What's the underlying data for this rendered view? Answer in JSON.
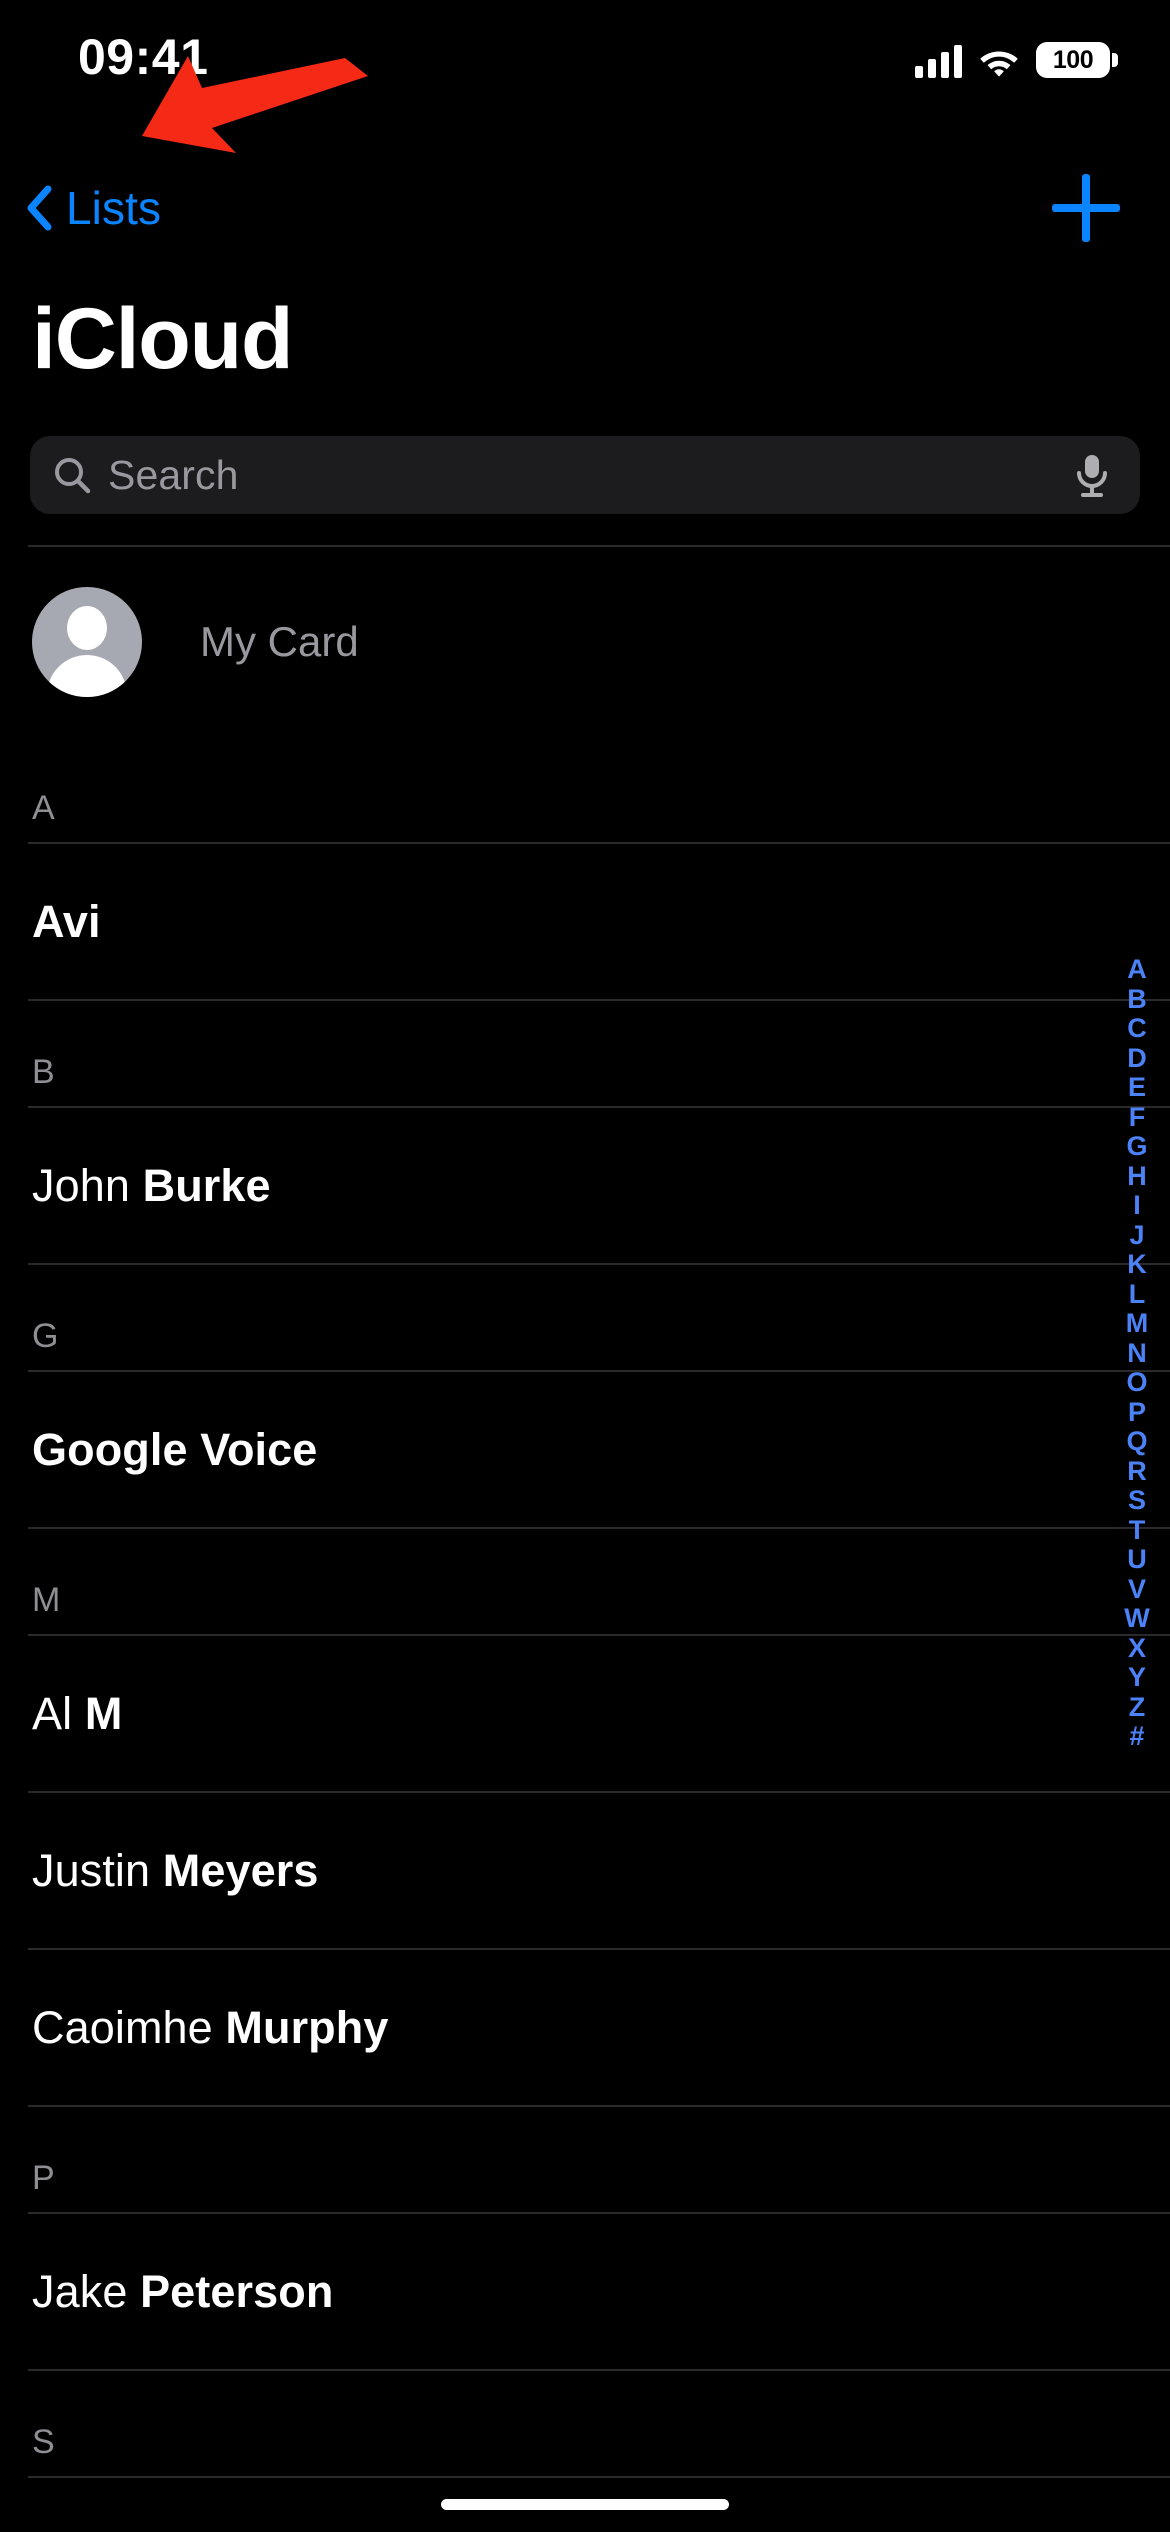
{
  "status_bar": {
    "time": "09:41",
    "cellular_icon": "cellular-bars-icon",
    "wifi_icon": "wifi-icon",
    "battery_percent": "100"
  },
  "nav": {
    "back_label": "Lists",
    "back_chevron_icon": "chevron-left-icon",
    "add_icon": "plus-icon",
    "accent_color": "#0A84FF"
  },
  "annotation": {
    "arrow_icon": "red-arrow-icon",
    "color": "#F42A16",
    "points_at": "Lists"
  },
  "header": {
    "title": "iCloud"
  },
  "search": {
    "placeholder": "Search",
    "value": "",
    "search_icon": "search-icon",
    "mic_icon": "microphone-icon"
  },
  "my_card": {
    "label": "My Card",
    "avatar_icon": "person-placeholder-avatar"
  },
  "sections": [
    {
      "letter": "A",
      "contacts": [
        {
          "first": "",
          "last": "Avi"
        }
      ]
    },
    {
      "letter": "B",
      "contacts": [
        {
          "first": "John ",
          "last": "Burke"
        }
      ]
    },
    {
      "letter": "G",
      "contacts": [
        {
          "first": "",
          "last": "Google Voice"
        }
      ]
    },
    {
      "letter": "M",
      "contacts": [
        {
          "first": "Al ",
          "last": "M"
        },
        {
          "first": "Justin ",
          "last": "Meyers"
        },
        {
          "first": "Caoimhe ",
          "last": "Murphy"
        }
      ]
    },
    {
      "letter": "P",
      "contacts": [
        {
          "first": "Jake ",
          "last": "Peterson"
        }
      ]
    },
    {
      "letter": "S",
      "contacts": []
    }
  ],
  "index_bar": {
    "letters": [
      "A",
      "B",
      "C",
      "D",
      "E",
      "F",
      "G",
      "H",
      "I",
      "J",
      "K",
      "L",
      "M",
      "N",
      "O",
      "P",
      "Q",
      "R",
      "S",
      "T",
      "U",
      "V",
      "W",
      "X",
      "Y",
      "Z",
      "#"
    ],
    "color": "#4C82F7"
  }
}
